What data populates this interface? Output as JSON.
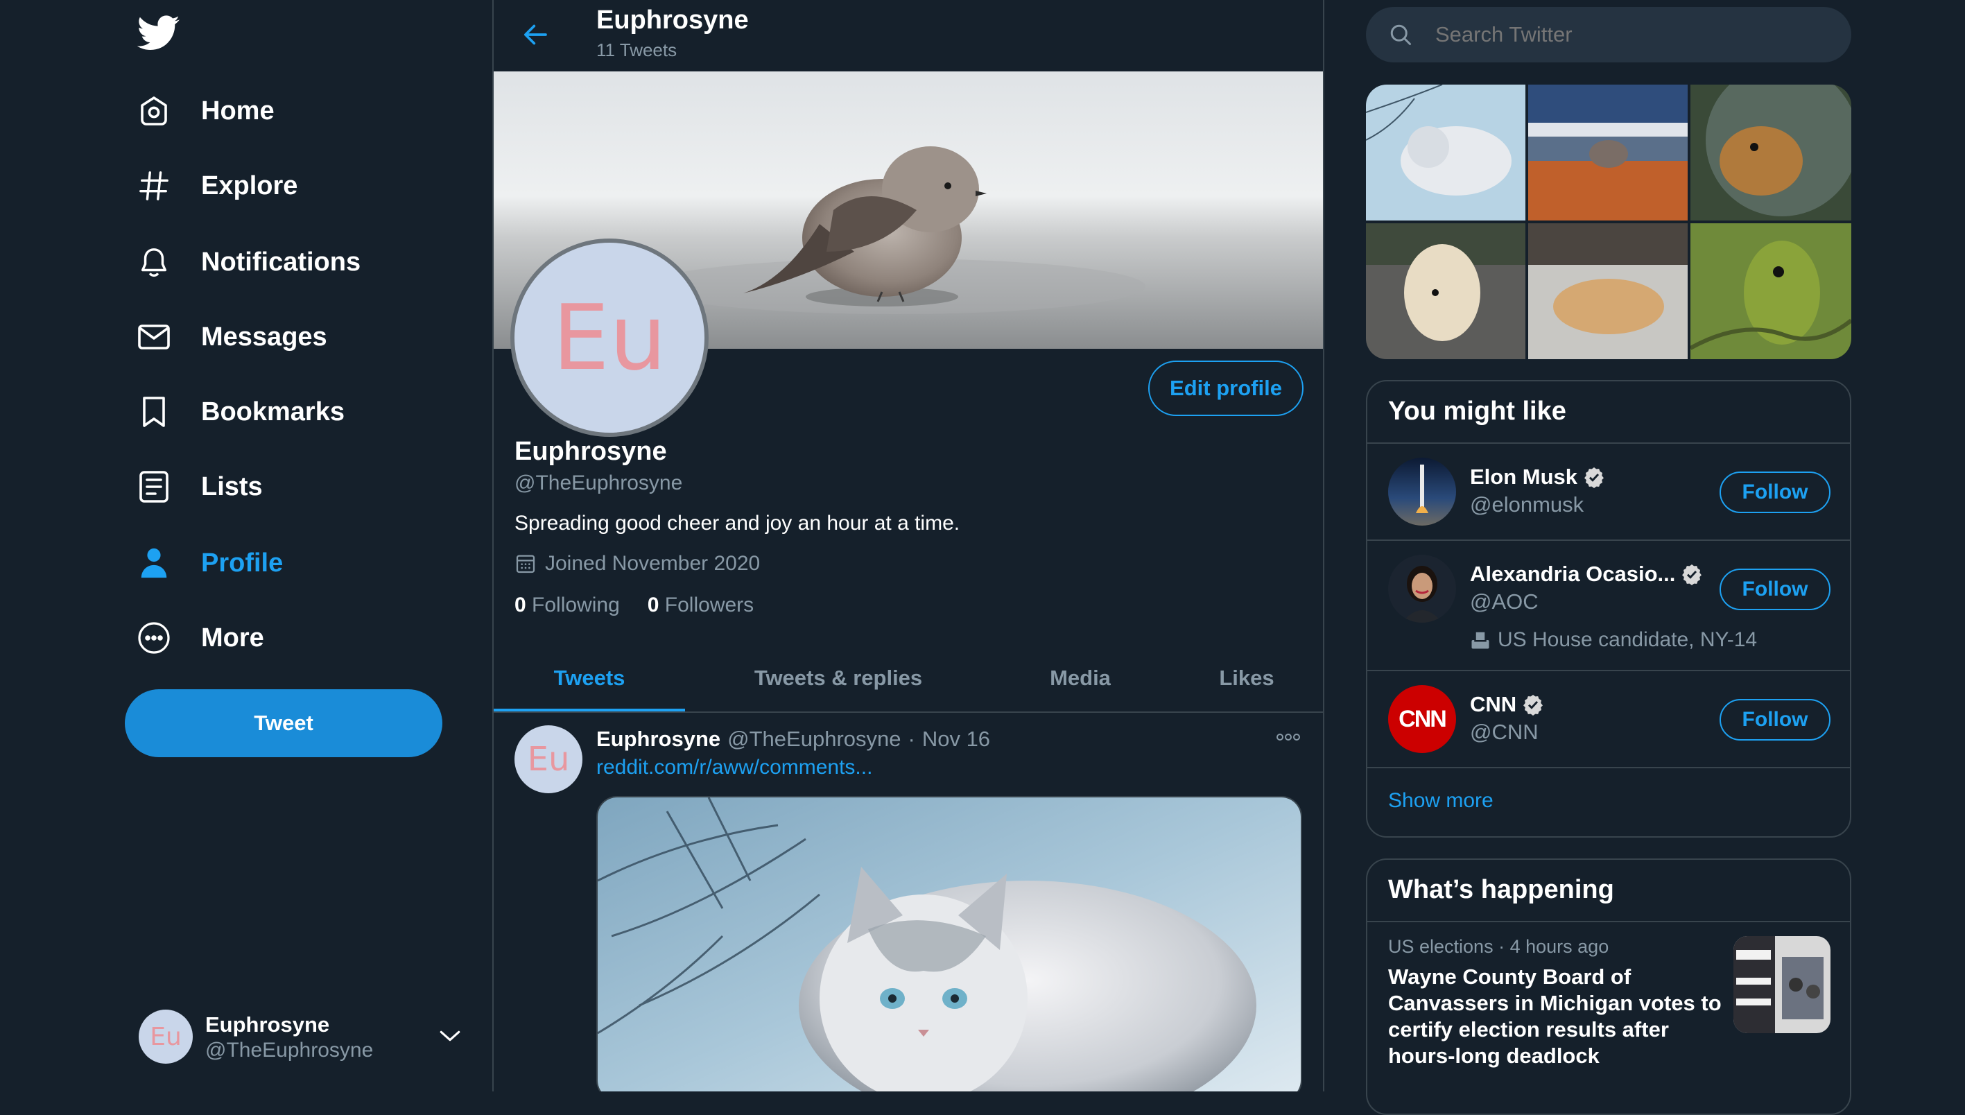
{
  "brand": {
    "logo": "twitter-bird-icon",
    "accent": "#1da1f2",
    "bg": "#15202b"
  },
  "nav": {
    "items": [
      {
        "label": "Home",
        "icon": "home-icon"
      },
      {
        "label": "Explore",
        "icon": "hashtag-icon"
      },
      {
        "label": "Notifications",
        "icon": "bell-icon"
      },
      {
        "label": "Messages",
        "icon": "envelope-icon"
      },
      {
        "label": "Bookmarks",
        "icon": "bookmark-icon"
      },
      {
        "label": "Lists",
        "icon": "list-icon"
      },
      {
        "label": "Profile",
        "icon": "person-icon",
        "active": true
      },
      {
        "label": "More",
        "icon": "more-circle-icon"
      }
    ],
    "tweet_button": "Tweet"
  },
  "account": {
    "name": "Euphrosyne",
    "handle": "@TheEuphrosyne",
    "avatar_text": "Eu"
  },
  "header": {
    "title": "Euphrosyne",
    "subtitle": "11 Tweets"
  },
  "profile": {
    "avatar_text": "Eu",
    "name": "Euphrosyne",
    "handle": "@TheEuphrosyne",
    "bio": "Spreading good cheer and joy an hour at a time.",
    "joined": "Joined November 2020",
    "following_count": "0",
    "following_label": "Following",
    "followers_count": "0",
    "followers_label": "Followers",
    "edit_button": "Edit profile"
  },
  "tabs": [
    {
      "label": "Tweets",
      "active": true
    },
    {
      "label": "Tweets & replies"
    },
    {
      "label": "Media"
    },
    {
      "label": "Likes"
    }
  ],
  "tweet": {
    "avatar_text": "Eu",
    "name": "Euphrosyne",
    "handle": "@TheEuphrosyne",
    "separator": "·",
    "date": "Nov 16",
    "link": "reddit.com/r/aww/comments..."
  },
  "search": {
    "placeholder": "Search Twitter"
  },
  "you_might_like": {
    "title": "You might like",
    "items": [
      {
        "name": "Elon Musk",
        "handle": "@elonmusk",
        "verified": true,
        "button": "Follow"
      },
      {
        "name": "Alexandria Ocasio...",
        "handle": "@AOC",
        "verified": true,
        "extra": "US House candidate, NY-14",
        "button": "Follow"
      },
      {
        "name": "CNN",
        "handle": "@CNN",
        "verified": true,
        "avatar_text": "CNN",
        "button": "Follow"
      }
    ],
    "show_more": "Show more"
  },
  "whats_happening": {
    "title": "What’s happening",
    "item": {
      "category": "US elections",
      "separator": "·",
      "time": "4 hours ago",
      "headline": "Wayne County Board of Canvassers in Michigan votes to certify election results after hours-long deadlock"
    }
  }
}
